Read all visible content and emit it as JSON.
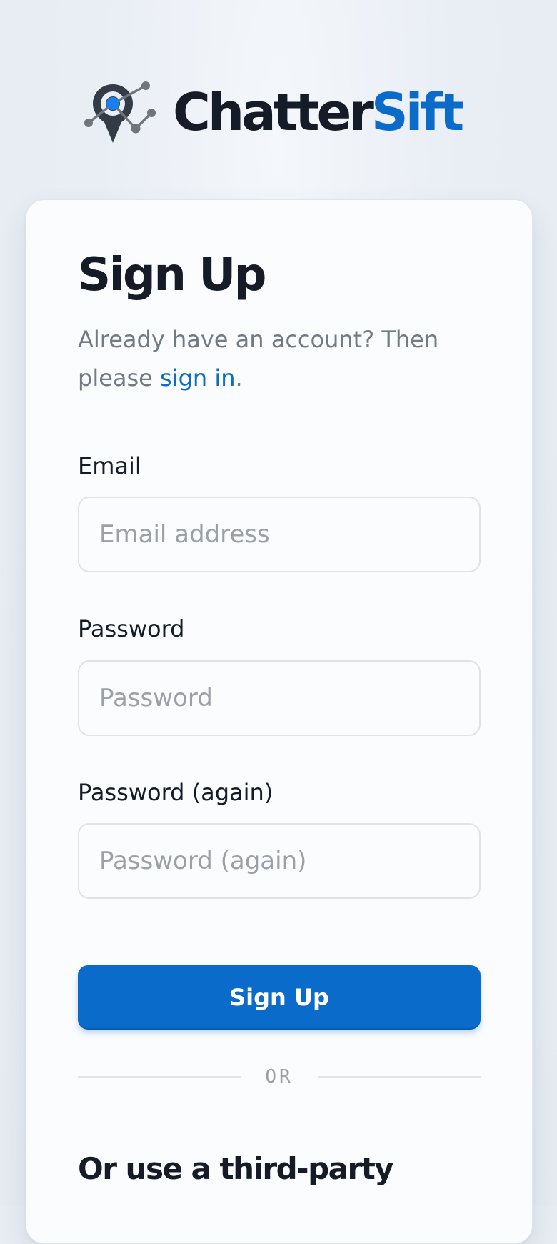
{
  "brand": {
    "name_part1": "Chatter",
    "name_part2": "Sift",
    "accent_color": "#0b6bcb",
    "icon": "map-pin-network-icon"
  },
  "signup": {
    "title": "Sign Up",
    "subtitle_text": "Already have an account? Then please ",
    "signin_link": "sign in",
    "subtitle_end": "."
  },
  "fields": {
    "email": {
      "label": "Email",
      "placeholder": "Email address"
    },
    "password": {
      "label": "Password",
      "placeholder": "Password"
    },
    "password_again": {
      "label": "Password (again)",
      "placeholder": "Password (again)"
    }
  },
  "actions": {
    "signup_label": "Sign Up"
  },
  "divider": {
    "text": "OR"
  },
  "third_party": {
    "heading": "Or use a third-party"
  }
}
